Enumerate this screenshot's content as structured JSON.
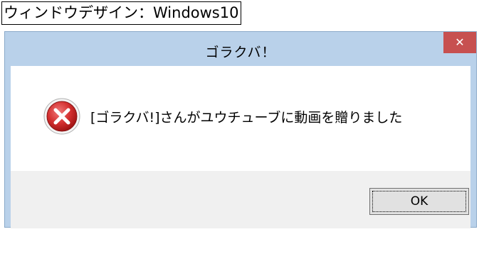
{
  "caption": "ウィンドウデザイン：Windows10",
  "dialog": {
    "title": "ゴラクバ！",
    "close_glyph": "✕",
    "message": "[ゴラクバ!]さんがユウチューブに動画を贈りました",
    "ok_label": "OK"
  },
  "colors": {
    "titlebar": "#b9d1ea",
    "close_button": "#c75050",
    "footer": "#f0f0f0",
    "error_icon": "#d32f2f"
  },
  "icons": {
    "error": "error-x-icon",
    "close": "close-icon"
  }
}
